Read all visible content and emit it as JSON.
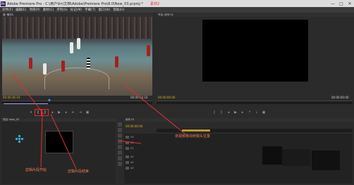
{
  "window": {
    "app_icon": "Pr",
    "title": "Adobe Premiere Pro - C:\\用户\\lin\\文档\\Adobe\\Premiere Pro\\8.0\\New_03.prproj *",
    "title_annotation": "素材2",
    "controls": [
      "—",
      "□",
      "✕"
    ]
  },
  "menu": [
    "文件(F)",
    "编辑(E)",
    "项目(P)",
    "素材(C)",
    "序列(S)",
    "标记(M)",
    "字幕(T)",
    "窗口(W)",
    "帮助(H)"
  ],
  "source_monitor": {
    "tab_label": "源: 素材2",
    "timecode_in": "00:00:36:10",
    "timecode_out": "00:00:14:10",
    "controls": [
      "mark-in-icon",
      "mark-out-icon",
      "step-back-icon",
      "play-icon",
      "step-forward-icon",
      "insert-icon",
      "overwrite-icon",
      "export-frame-icon"
    ]
  },
  "program_monitor": {
    "tab_label": "节目: 序列 01",
    "timecode_in": "00:00:00:00",
    "timecode_out": "00:00:00:00"
  },
  "project_panel": {
    "tab_label": "项目: New_03"
  },
  "timeline": {
    "tab_label": "序列 01",
    "timecode": "00:00:00:00",
    "tracks": [
      "V3",
      "V2",
      "V1",
      "A1",
      "A2",
      "A3"
    ]
  },
  "annotations": {
    "in_point": "剪辑片段开始",
    "out_point": "剪辑片段结束",
    "drag_clip": "将视频移动到镜头位置"
  },
  "colors": {
    "annotation": "#e0302c",
    "timecode": "#ddb000",
    "accent": "#4a8cff"
  }
}
